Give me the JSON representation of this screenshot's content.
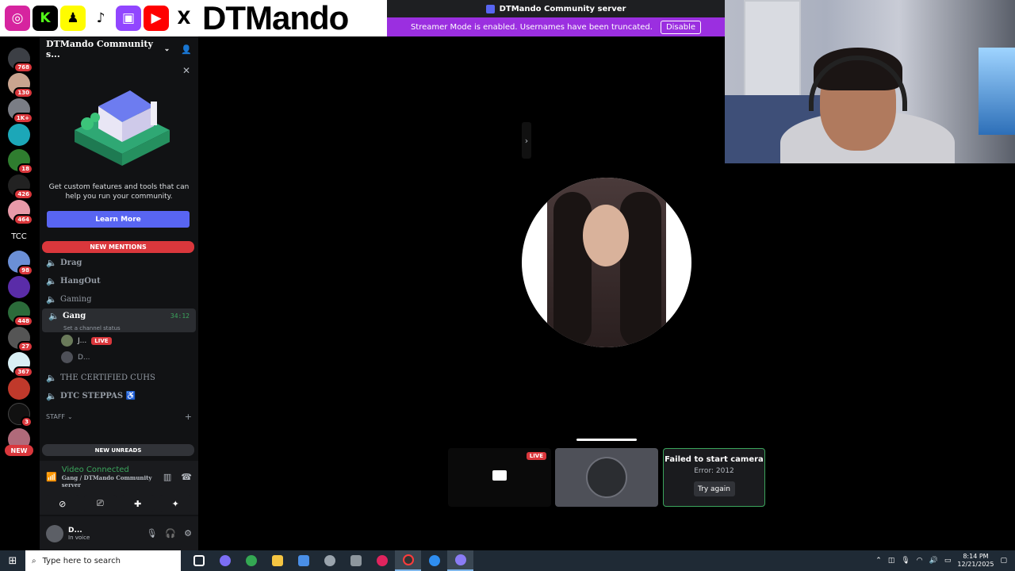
{
  "overlay": {
    "brand": "DTMando",
    "social_icons": [
      {
        "name": "instagram-icon",
        "color": "#e1306c",
        "glyph": "◎"
      },
      {
        "name": "kick-icon",
        "color": "#53fc18",
        "glyph": "K"
      },
      {
        "name": "snapchat-icon",
        "color": "#fffc00",
        "glyph": "♟"
      },
      {
        "name": "tiktok-icon",
        "color": "#000000",
        "glyph": "♪"
      },
      {
        "name": "twitch-icon",
        "color": "#9146ff",
        "glyph": "▣"
      },
      {
        "name": "youtube-icon",
        "color": "#ff0000",
        "glyph": "▶"
      },
      {
        "name": "x-icon",
        "color": "#000000",
        "glyph": "X"
      }
    ]
  },
  "window": {
    "title": "DTMando Community server",
    "streamer_banner": "Streamer Mode is enabled. Usernames have been truncated.",
    "disable_label": "Disable"
  },
  "rail": {
    "badges": [
      "768",
      "130",
      "1K+",
      "",
      "18",
      "426",
      "464",
      "98",
      "448",
      "27",
      "367",
      "",
      "3"
    ],
    "tcc_label": "TCC",
    "new_label": "NEW"
  },
  "server": {
    "name": "DTMando Community s...",
    "promo_text": "Get custom features and tools that can help you run your community.",
    "learn_more": "Learn More",
    "new_mentions": "NEW MENTIONS",
    "channels": [
      {
        "name": "Drag"
      },
      {
        "name": "HangOut"
      },
      {
        "name": "Gaming"
      }
    ],
    "active_channel": {
      "name": "Gang",
      "time": "34:12",
      "status": "Set a channel status"
    },
    "voice_users": [
      {
        "name": "J...",
        "live": "LIVE"
      },
      {
        "name": "D..."
      }
    ],
    "more_channels": [
      {
        "name": "THE CERTIFIED CUHS"
      },
      {
        "name": "DTC STEPPAS ♿"
      }
    ],
    "category": "STAFF",
    "new_unreads": "NEW UNREADS"
  },
  "voice": {
    "status": "Video Connected",
    "location": "Gang / DTMando Community server"
  },
  "me": {
    "name": "D...",
    "status": "In voice"
  },
  "stage": {
    "live_label": "LIVE",
    "error_title": "Failed to start camera",
    "error_code": "Error: 2012",
    "retry": "Try again"
  },
  "taskbar": {
    "search_placeholder": "Type here to search",
    "time": "8:14 PM",
    "date": "12/21/2025",
    "apps": [
      {
        "name": "task-view-icon",
        "color": "#ffffff"
      },
      {
        "name": "copilot-icon",
        "color": "#7c6ef5"
      },
      {
        "name": "chrome-icon",
        "color": "#34a853"
      },
      {
        "name": "file-explorer-icon",
        "color": "#f5c542"
      },
      {
        "name": "store-icon",
        "color": "#4a8fe7"
      },
      {
        "name": "settings-icon",
        "color": "#9aa4ad"
      },
      {
        "name": "xbox-icon",
        "color": "#8d969d"
      },
      {
        "name": "media-player-icon",
        "color": "#e0245e"
      },
      {
        "name": "obs-icon",
        "color": "#ff3c3c"
      },
      {
        "name": "edge-icon",
        "color": "#2f8ef0"
      },
      {
        "name": "discord-icon",
        "color": "#8a7cf5"
      }
    ]
  }
}
